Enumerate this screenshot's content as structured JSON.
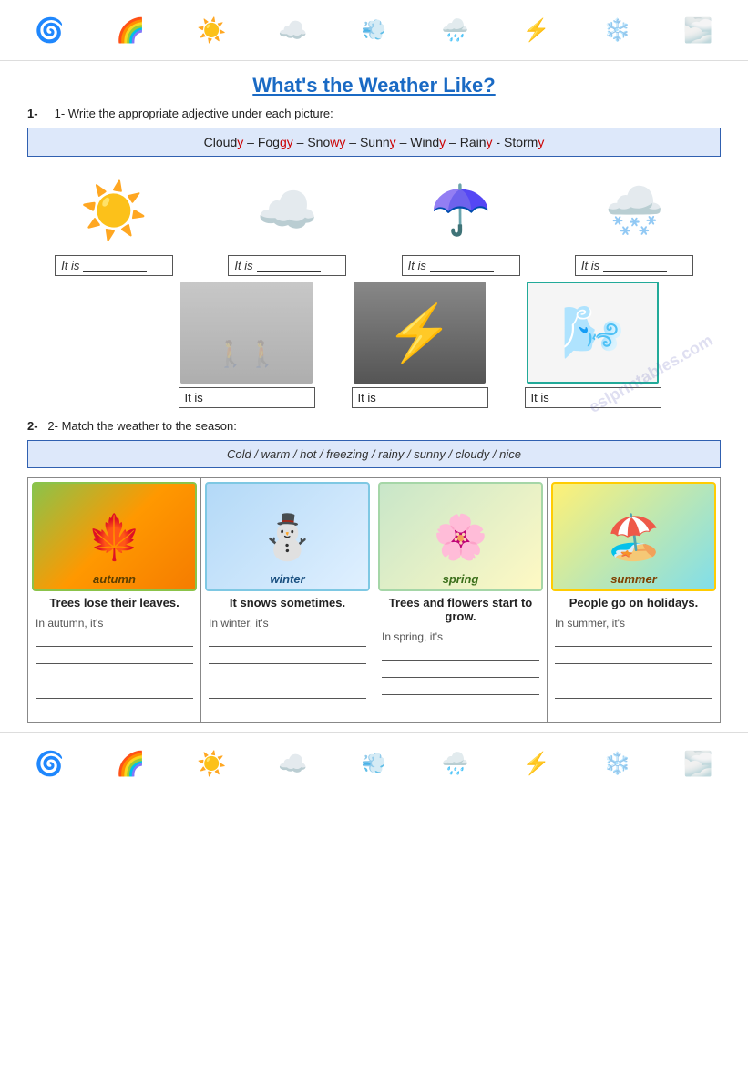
{
  "title": "What's the Weather Like?",
  "header": {
    "icons": [
      "🌀",
      "🌈",
      "☀️",
      "☁️",
      "💨",
      "🌧️",
      "⚡",
      "❄️",
      "🌫️"
    ]
  },
  "section1": {
    "label": "1-    Write the appropriate adjective under each picture:",
    "word_bank": "Cloudy – Foggy – Snowy – Sunny – Windy – Rainy - Stormy",
    "word_bank_red_letters": [
      "y",
      "y",
      "y",
      "y",
      "y",
      "y",
      "y"
    ],
    "pictures_row1": [
      {
        "icon": "☀️",
        "label": "It is",
        "line": true
      },
      {
        "icon": "☁️",
        "label": "It is",
        "line": true
      },
      {
        "icon": "☂️",
        "label": "It is",
        "line": true
      },
      {
        "icon": "🌨️",
        "label": "It is",
        "line": true
      }
    ],
    "pictures_row2": [
      {
        "type": "foggy",
        "label": "It is",
        "line": true
      },
      {
        "type": "storm",
        "label": "It is",
        "line": true
      },
      {
        "type": "windy",
        "label": "It is",
        "line": true
      }
    ]
  },
  "section2": {
    "label": "2-  Match the weather to the season:",
    "word_bank": "Cold / warm / hot / freezing / rainy / sunny / cloudy / nice",
    "seasons": [
      {
        "name": "autumn",
        "emoji": "🍂",
        "label": "autumn",
        "desc": "Trees lose their leaves.",
        "fill_label": "In autumn, it's"
      },
      {
        "name": "winter",
        "emoji": "⛄",
        "label": "winter",
        "desc": "It snows sometimes.",
        "fill_label": "In winter, it's"
      },
      {
        "name": "spring",
        "emoji": "🌸",
        "label": "spring",
        "desc": "Trees and flowers start to grow.",
        "fill_label": "In spring, it's"
      },
      {
        "name": "summer",
        "emoji": "🏖️",
        "label": "summer",
        "desc": "People go on holidays.",
        "fill_label": "In summer, it's"
      }
    ]
  },
  "watermark": "eslprintables.com"
}
